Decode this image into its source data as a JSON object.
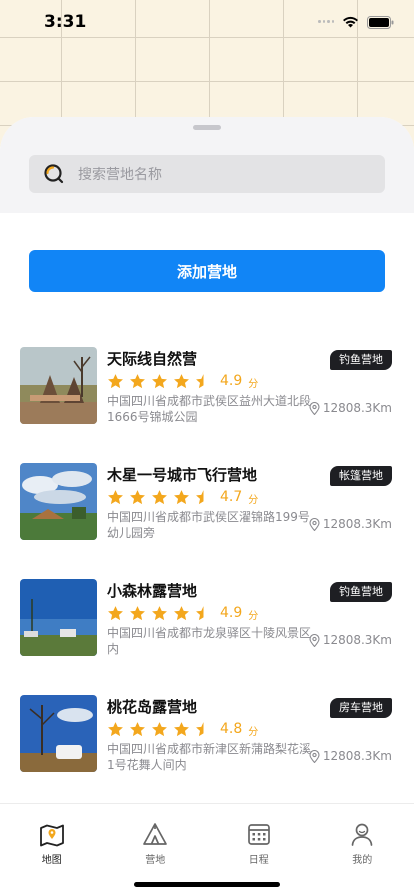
{
  "status": {
    "time": "3:31"
  },
  "search": {
    "placeholder": "搜索营地名称"
  },
  "add_button": "添加营地",
  "camps": [
    {
      "name": "天际线自然营",
      "tag": "钓鱼营地",
      "rating": 4.9,
      "score": "4.9",
      "unit": "分",
      "address": "中国四川省成都市武侯区益州大道北段1666号锦城公园",
      "distance": "12808.3Km"
    },
    {
      "name": "木星一号城市飞行营地",
      "tag": "帐篷营地",
      "rating": 4.7,
      "score": "4.7",
      "unit": "分",
      "address": "中国四川省成都市武侯区濯锦路199号幼儿园旁",
      "distance": "12808.3Km"
    },
    {
      "name": "小森林露营地",
      "tag": "钓鱼营地",
      "rating": 4.9,
      "score": "4.9",
      "unit": "分",
      "address": "中国四川省成都市龙泉驿区十陵风景区内",
      "distance": "12808.3Km"
    },
    {
      "name": "桃花岛露营地",
      "tag": "房车营地",
      "rating": 4.8,
      "score": "4.8",
      "unit": "分",
      "address": "中国四川省成都市新津区新蒲路梨花溪1号花舞人间内",
      "distance": "12808.3Km"
    }
  ],
  "tabs": [
    {
      "label": "地图",
      "icon": "map-icon",
      "active": true
    },
    {
      "label": "营地",
      "icon": "tent-icon",
      "active": false
    },
    {
      "label": "日程",
      "icon": "calendar-icon",
      "active": false
    },
    {
      "label": "我的",
      "icon": "profile-icon",
      "active": false
    }
  ],
  "colors": {
    "accent": "#1185f6",
    "star": "#f3a71d",
    "tag_bg": "#1e1f23"
  }
}
